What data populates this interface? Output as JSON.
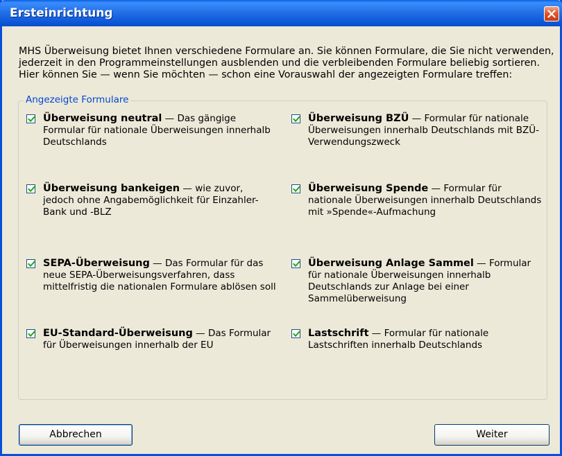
{
  "window": {
    "title": "Ersteinrichtung",
    "close_icon": "close-icon"
  },
  "intro_text": "MHS Überweisung bietet Ihnen verschiedene Formulare an. Sie können Formulare, die Sie nicht verwenden, jederzeit in den Programmeinstellungen ausblenden und die verbleibenden Formulare beliebig sortieren. Hier können Sie — wenn Sie möchten — schon eine Vorauswahl der angezeigten Formulare treffen:",
  "group": {
    "label": "Angezeigte Formulare",
    "options": [
      {
        "title": "Überweisung neutral",
        "desc": " — Das gängige Formular für nationale Überweisungen innerhalb Deutschlands",
        "checked": true
      },
      {
        "title": "Überweisung BZÜ",
        "desc": " — Formular für nationale Überweisungen innerhalb Deutschlands mit BZÜ-Verwendungszweck",
        "checked": true
      },
      {
        "title": "Überweisung bankeigen",
        "desc": " — wie zuvor, jedoch ohne Angabemöglichkeit für Einzahler-Bank und -BLZ",
        "checked": true
      },
      {
        "title": "Überweisung Spende",
        "desc": " — Formular für nationale Überweisungen innerhalb Deutschlands mit »Spende«-Aufmachung",
        "checked": true
      },
      {
        "title": "SEPA-Überweisung",
        "desc": " — Das Formular für das neue SEPA-Überweisungsverfahren, dass mittelfristig die nationalen Formulare ablösen soll",
        "checked": true
      },
      {
        "title": "Überweisung Anlage Sammel",
        "desc": " — Formular für nationale Überweisungen innerhalb Deutschlands zur Anlage bei einer Sammelüberweisung",
        "checked": true
      },
      {
        "title": "EU-Standard-Überweisung",
        "desc": " — Das Formular für Überweisungen innerhalb der EU",
        "checked": true
      },
      {
        "title": "Lastschrift",
        "desc": " — Formular für nationale Lastschriften innerhalb Deutschlands",
        "checked": true
      }
    ]
  },
  "buttons": {
    "cancel": "Abbrechen",
    "next": "Weiter"
  },
  "colors": {
    "titlebar": "#0a5fe4",
    "window_bg": "#ece9d8",
    "group_label": "#0046d5",
    "close_button": "#e0582c"
  }
}
